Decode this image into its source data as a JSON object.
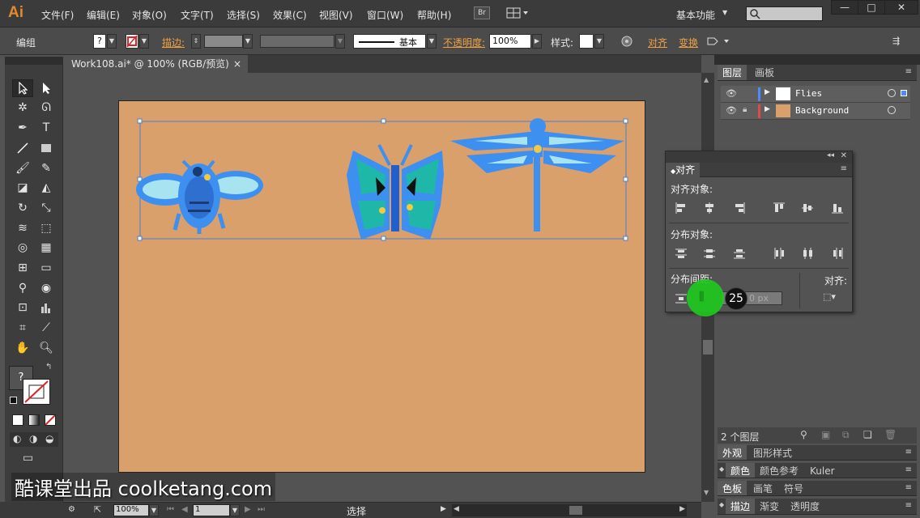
{
  "app": {
    "logo": "Ai",
    "workspace": "基本功能",
    "br_button": "Br"
  },
  "menu": [
    "文件(F)",
    "编辑(E)",
    "对象(O)",
    "文字(T)",
    "选择(S)",
    "效果(C)",
    "视图(V)",
    "窗口(W)",
    "帮助(H)"
  ],
  "controlbar": {
    "selection_label": "编组",
    "fill_swatch": "?",
    "stroke_label": "描边:",
    "stroke_style_label": "基本",
    "opacity_label": "不透明度:",
    "opacity_value": "100%",
    "style_label": "样式:",
    "align_label": "对齐",
    "transform_label": "变换"
  },
  "document_tab": {
    "title": "Work108.ai* @ 100% (RGB/预览)",
    "close": "×"
  },
  "tools_panel": {
    "fill_question": "?"
  },
  "layers_panel": {
    "tabs": [
      "图层",
      "画板"
    ],
    "layers": [
      {
        "name": "Flies",
        "color": "#4a8cff"
      },
      {
        "name": "Background",
        "color": "#e24a4a"
      }
    ],
    "footer_count": "2 个图层"
  },
  "panels_below": {
    "appearance_tabs": [
      "外观",
      "图形样式"
    ],
    "color_tabs": [
      "颜色",
      "颜色参考",
      "Kuler"
    ],
    "swatch_tabs": [
      "色板",
      "画笔",
      "符号"
    ],
    "stroke_tabs": [
      "描边",
      "渐变",
      "透明度"
    ]
  },
  "align_panel": {
    "title": "对齐",
    "align_objects_label": "对齐对象:",
    "distribute_objects_label": "分布对象:",
    "distribute_spacing_label": "分布间距:",
    "align_to_label": "对齐:",
    "spacing_value": "0 px",
    "step_badge": "25"
  },
  "statusbar": {
    "zoom": "100%",
    "artboard_number": "1",
    "tool_name": "选择"
  },
  "watermark": "酷课堂出品 coolketang.com",
  "colors": {
    "artboard": "#d9a06c",
    "insect_blue": "#3d8ff0",
    "insect_teal": "#1fb8a8",
    "insect_light": "#a7e4f0",
    "accent_orange": "#e08a2c",
    "highlight_green": "#1ec81e"
  }
}
